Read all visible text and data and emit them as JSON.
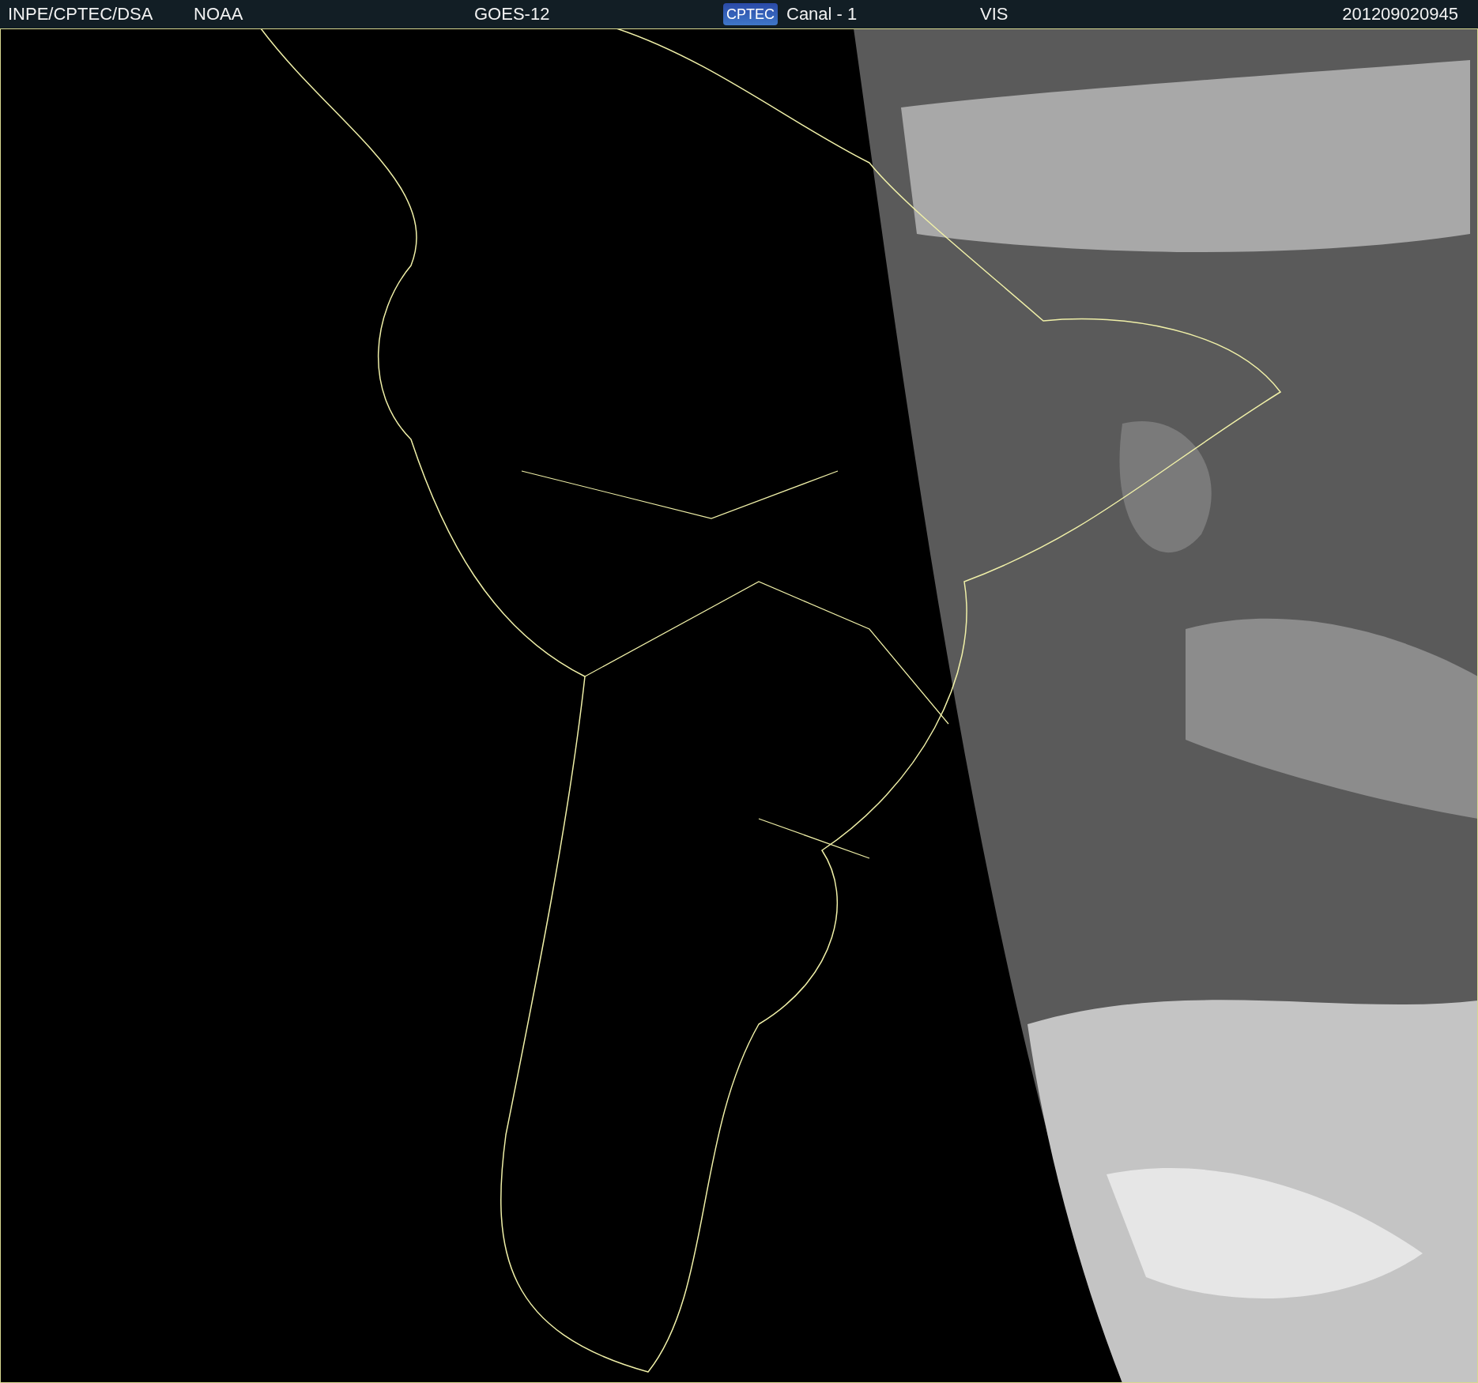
{
  "header": {
    "items": [
      {
        "kind": "text",
        "text": "INPE/CPTEC/DSA"
      },
      {
        "kind": "text",
        "text": "NOAA"
      },
      {
        "kind": "text",
        "text": "GOES-12"
      },
      {
        "kind": "logo",
        "text": "CPTEC"
      },
      {
        "kind": "text",
        "text": "Canal - 1"
      },
      {
        "kind": "text",
        "text": "VIS"
      },
      {
        "kind": "text",
        "text": "201209020945"
      }
    ]
  }
}
